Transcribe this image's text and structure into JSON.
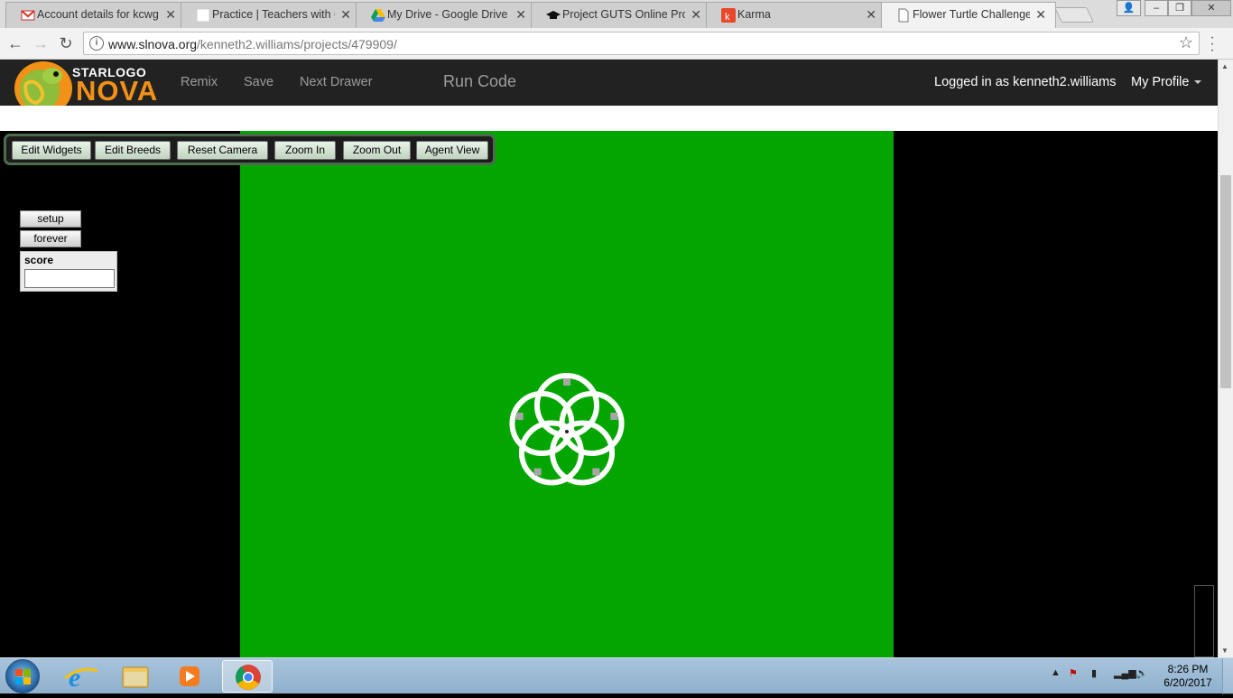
{
  "browser": {
    "tabs": [
      {
        "title": "Account details for kcwg",
        "icon": "gmail-icon",
        "active": false
      },
      {
        "title": "Practice | Teachers with G",
        "icon": "blank-page-icon",
        "active": false
      },
      {
        "title": "My Drive - Google Drive",
        "icon": "google-drive-icon",
        "active": false
      },
      {
        "title": "Project GUTS Online Prof",
        "icon": "graduation-cap-icon",
        "active": false
      },
      {
        "title": "Karma",
        "icon": "karma-icon",
        "active": false
      },
      {
        "title": "Flower Turtle Challenge",
        "icon": "page-icon",
        "active": true
      }
    ],
    "url_domain": "www.slnova.org",
    "url_path": "/kenneth2.williams/projects/479909/"
  },
  "header": {
    "logo_top": "STARLOGO",
    "logo_bottom": "NOVA",
    "nav": [
      "Remix",
      "Save",
      "Next Drawer"
    ],
    "run_code": "Run Code",
    "logged_in": "Logged in as kenneth2.williams",
    "profile": "My Profile"
  },
  "camera_toolbar": [
    "Edit Widgets",
    "Edit Breeds",
    "Reset Camera",
    "Zoom In",
    "Zoom Out",
    "Agent View"
  ],
  "widgets": {
    "setup": "setup",
    "forever": "forever",
    "score_label": "score",
    "score_value": ""
  },
  "world": {
    "background": "#03a600",
    "pattern": "flower of five white circles",
    "circle_count": 5,
    "trail_color": "#ffffff",
    "turtle_color": "#a6a6a6"
  },
  "taskbar": {
    "apps": [
      "internet-explorer-icon",
      "file-explorer-icon",
      "media-player-icon",
      "chrome-icon"
    ],
    "time": "8:26 PM",
    "date": "6/20/2017"
  }
}
